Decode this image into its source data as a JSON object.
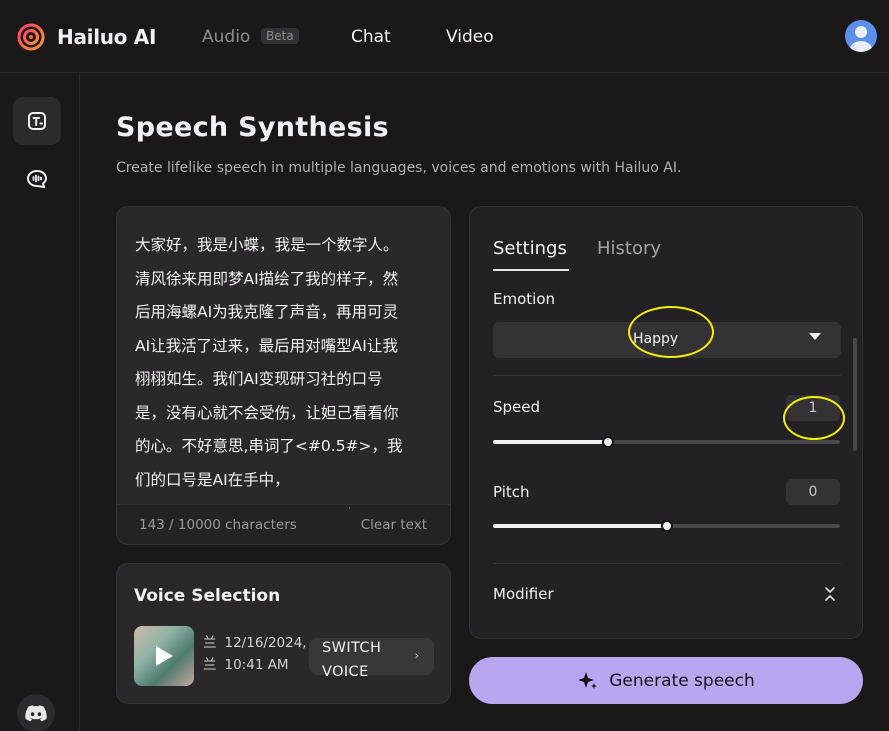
{
  "header": {
    "brand": "Hailuo AI",
    "nav": {
      "audio": "Audio",
      "beta_badge": "Beta",
      "chat": "Chat",
      "video": "Video"
    }
  },
  "sidebar": {
    "items": [
      {
        "icon": "text-to-speech-icon",
        "active": true
      },
      {
        "icon": "voice-chat-icon",
        "active": false
      }
    ],
    "footer_icon": "discord-icon"
  },
  "main": {
    "title": "Speech Synthesis",
    "subtitle": "Create lifelike speech in multiple languages, voices and emotions with Hailuo AI."
  },
  "text_input": {
    "content": "大家好，我是小蝶，我是一个数字人。清风徐来用即梦AI描绘了我的样子，然后用海螺AI为我克隆了声音，再用可灵AI让我活了过来，最后用对嘴型AI让我栩栩如生。我们AI变现研习社的口号是，没有心就不会受伤，让妲己看看你的心。不好意思,串词了<#0.5#>，我们的口号是AI在手中，",
    "char_count": "143 / 10000 characters",
    "clear_label": "Clear text"
  },
  "voice_selection": {
    "title": "Voice Selection",
    "date": "12/16/2024,",
    "time": "10:41 AM",
    "switch_label": "SWITCH VOICE"
  },
  "settings_panel": {
    "tabs": [
      "Settings",
      "History"
    ],
    "active_tab": "Settings",
    "emotion": {
      "label": "Emotion",
      "value": "Happy"
    },
    "speed": {
      "label": "Speed",
      "value": "1",
      "slider_fraction": 0.33
    },
    "pitch": {
      "label": "Pitch",
      "value": "0",
      "slider_fraction": 0.5
    },
    "modifier": {
      "label": "Modifier"
    }
  },
  "generate": {
    "label": "Generate speech"
  },
  "colors": {
    "background": "#1a1819",
    "panel": "#2a282a",
    "accent": "#b9a6f1",
    "annotation": "#f3f000"
  }
}
